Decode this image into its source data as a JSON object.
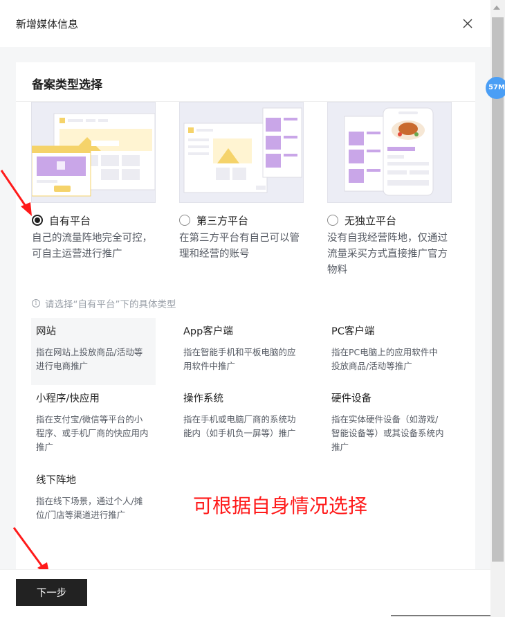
{
  "dialog": {
    "title": "新增媒体信息"
  },
  "section": {
    "title": "备案类型选择"
  },
  "platforms": [
    {
      "label": "自有平台",
      "desc": "自己的流量阵地完全可控，可自主运营进行推广",
      "checked": true
    },
    {
      "label": "第三方平台",
      "desc": "在第三方平台有自己可以管理和经营的账号",
      "checked": false
    },
    {
      "label": "无独立平台",
      "desc": "没有自我经营阵地，仅通过流量采买方式直接推广官方物料",
      "checked": false
    }
  ],
  "hint": "请选择“自有平台”下的具体类型",
  "types": [
    {
      "name": "网站",
      "desc": "指在网站上投放商品/活动等进行电商推广",
      "selected": true
    },
    {
      "name": "App客户端",
      "desc": "指在智能手机和平板电脑的应用软件中推广",
      "selected": false
    },
    {
      "name": "PC客户端",
      "desc": "指在PC电脑上的应用软件中投放商品/活动等推广",
      "selected": false
    },
    {
      "name": "小程序/快应用",
      "desc": "指在支付宝/微信等平台的小程序、或手机厂商的快应用内推广",
      "selected": false
    },
    {
      "name": "操作系统",
      "desc": "指在手机或电脑厂商的系统功能内（如手机负一屏等）推广",
      "selected": false
    },
    {
      "name": "硬件设备",
      "desc": "指在实体硬件设备（如游戏/智能设备等）或其设备系统内推广",
      "selected": false
    },
    {
      "name": "线下阵地",
      "desc": "指在线下场景，通过个人/摊位/门店等渠道进行推广",
      "selected": false
    }
  ],
  "annotation": "可根据自身情况选择",
  "footer": {
    "next_label": "下一步"
  },
  "badge": {
    "text": "57M"
  },
  "colors": {
    "accent_purple": "#c9a6e8",
    "accent_yellow": "#f5d36a",
    "annotation_red": "#ff1a1a",
    "button_dark": "#222222"
  }
}
